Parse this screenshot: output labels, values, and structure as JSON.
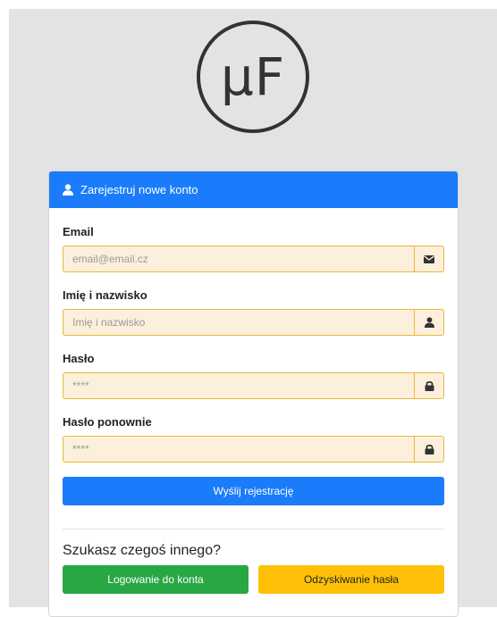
{
  "logo": {
    "text": "μF"
  },
  "card": {
    "header_title": "Zarejestruj nowe konto",
    "header_icon": "user-icon"
  },
  "form": {
    "email": {
      "label": "Email",
      "placeholder": "email@email.cz",
      "icon": "envelope-icon"
    },
    "name": {
      "label": "Imię i nazwisko",
      "placeholder": "Imię i nazwisko",
      "icon": "user-icon"
    },
    "password": {
      "label": "Hasło",
      "placeholder": "****",
      "icon": "lock-icon"
    },
    "password_repeat": {
      "label": "Hasło ponownie",
      "placeholder": "****",
      "icon": "lock-icon"
    },
    "submit_label": "Wyślij rejestrację"
  },
  "footer": {
    "other_text": "Szukasz czegoś innego?",
    "login_label": "Logowanie do konta",
    "recover_label": "Odzyskiwanie hasła"
  },
  "colors": {
    "primary": "#1a7cfa",
    "success": "#28a745",
    "warning": "#ffc107",
    "input_bg": "#fcf0dc",
    "input_border": "#e8b83a"
  }
}
